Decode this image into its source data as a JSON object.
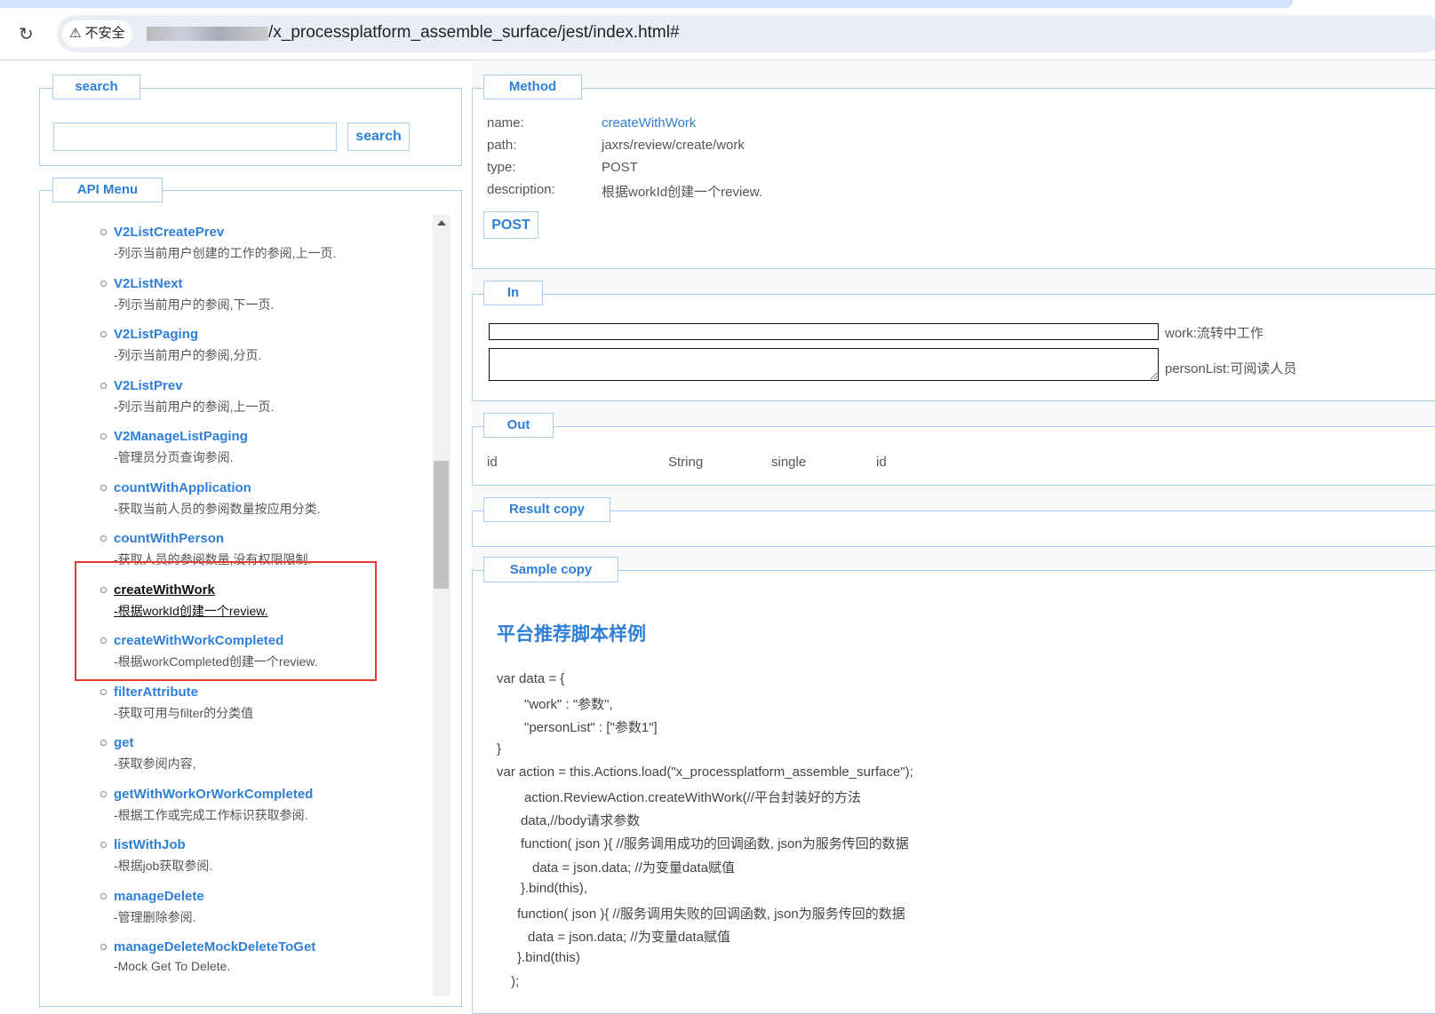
{
  "browser": {
    "insecure_label": "不安全",
    "url": "/x_processplatform_assemble_surface/jest/index.html#"
  },
  "search": {
    "legend": "search",
    "input_value": "",
    "button": "search"
  },
  "menu": {
    "legend": "API Menu",
    "items": [
      {
        "title": "V2ListCreatePrev",
        "desc": "-列示当前用户创建的工作的参阅,上一页."
      },
      {
        "title": "V2ListNext",
        "desc": "-列示当前用户的参阅,下一页."
      },
      {
        "title": "V2ListPaging",
        "desc": "-列示当前用户的参阅,分页."
      },
      {
        "title": "V2ListPrev",
        "desc": "-列示当前用户的参阅,上一页."
      },
      {
        "title": "V2ManageListPaging",
        "desc": "-管理员分页查询参阅."
      },
      {
        "title": "countWithApplication",
        "desc": "-获取当前人员的参阅数量按应用分类."
      },
      {
        "title": "countWithPerson",
        "desc": "-获取人员的参阅数量,没有权限限制."
      },
      {
        "title": "createWithWork",
        "desc": "-根据workId创建一个review."
      },
      {
        "title": "createWithWorkCompleted",
        "desc": "-根据workCompleted创建一个review."
      },
      {
        "title": "filterAttribute",
        "desc": "-获取可用与filter的分类值"
      },
      {
        "title": "get",
        "desc": "-获取参阅内容,"
      },
      {
        "title": "getWithWorkOrWorkCompleted",
        "desc": "-根据工作或完成工作标识获取参阅."
      },
      {
        "title": "listWithJob",
        "desc": "-根据job获取参阅."
      },
      {
        "title": "manageDelete",
        "desc": "-管理删除参阅."
      },
      {
        "title": "manageDeleteMockDeleteToGet",
        "desc": "-Mock Get To Delete."
      }
    ],
    "active_index": 7,
    "scroll_position": 0.55
  },
  "method": {
    "legend": "Method",
    "name_label": "name:",
    "name": "createWithWork",
    "path_label": "path:",
    "path": "jaxrs/review/create/work",
    "type_label": "type:",
    "type": "POST",
    "desc_label": "description:",
    "description": "根据workId创建一个review.",
    "button": "POST"
  },
  "in": {
    "legend": "In",
    "work_value": "",
    "work_label": "work:流转中工作",
    "personList_value": "",
    "personList_label": "personList:可阅读人员"
  },
  "out": {
    "legend": "Out",
    "row": [
      "id",
      "String",
      "single",
      "id"
    ]
  },
  "result": {
    "legend": "Result copy"
  },
  "sample": {
    "legend": "Sample copy",
    "heading": "平台推荐脚本样例",
    "lines": [
      "var data = {",
      "\"work\" : \"参数\",",
      "\"personList\" : [\"参数1\"]",
      "}",
      "var action = this.Actions.load(\"x_processplatform_assemble_surface\");",
      "action.ReviewAction.createWithWork(//平台封装好的方法",
      "data,//body请求参数",
      "function( json ){ //服务调用成功的回调函数, json为服务传回的数据",
      "data = json.data; //为变量data赋值",
      "}.bind(this),",
      "function( json ){ //服务调用失败的回调函数, json为服务传回的数据",
      "data = json.data; //为变量data赋值",
      "}.bind(this)",
      ");"
    ]
  }
}
